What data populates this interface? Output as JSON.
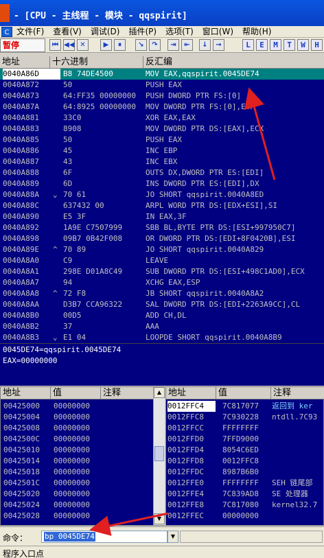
{
  "window": {
    "title": "- [CPU - 主线程 - 模块 - qqspirit]",
    "close_glyph": "×"
  },
  "menu": {
    "items": [
      "文件(F)",
      "查看(V)",
      "调试(D)",
      "插件(P)",
      "选项(T)",
      "窗口(W)",
      "帮助(H)"
    ],
    "system_glyph": "C"
  },
  "toolbar": {
    "status": "暂停",
    "buttons": [
      "⏮",
      "◀◀",
      "✕",
      "▶",
      "⏸",
      "↘",
      "↷",
      "⇥",
      "⇤",
      "↓",
      "→"
    ],
    "letters": [
      "L",
      "E",
      "M",
      "T",
      "W",
      "H"
    ]
  },
  "cpu": {
    "headers": [
      "地址",
      "十六进制",
      "反汇编"
    ],
    "rows": [
      {
        "addr": "0040A86D",
        "mark": "",
        "hex": "B8 74DE4500",
        "asm": "MOV EAX,qqspirit.0045DE74",
        "selected": true
      },
      {
        "addr": "0040A872",
        "mark": "",
        "hex": "50",
        "asm": "PUSH EAX"
      },
      {
        "addr": "0040A873",
        "mark": "",
        "hex": "64:FF35 00000000",
        "asm": "PUSH DWORD PTR FS:[0]"
      },
      {
        "addr": "0040A87A",
        "mark": "",
        "hex": "64:8925 00000000",
        "asm": "MOV DWORD PTR FS:[0],ESP"
      },
      {
        "addr": "0040A881",
        "mark": "",
        "hex": "33C0",
        "asm": "XOR EAX,EAX"
      },
      {
        "addr": "0040A883",
        "mark": "",
        "hex": "8908",
        "asm": "MOV DWORD PTR DS:[EAX],ECX"
      },
      {
        "addr": "0040A885",
        "mark": "",
        "hex": "50",
        "asm": "PUSH EAX"
      },
      {
        "addr": "0040A886",
        "mark": "",
        "hex": "45",
        "asm": "INC EBP"
      },
      {
        "addr": "0040A887",
        "mark": "",
        "hex": "43",
        "asm": "INC EBX"
      },
      {
        "addr": "0040A888",
        "mark": "",
        "hex": "6F",
        "asm": "OUTS DX,DWORD PTR ES:[EDI]"
      },
      {
        "addr": "0040A889",
        "mark": "",
        "hex": "6D",
        "asm": "INS DWORD PTR ES:[EDI],DX"
      },
      {
        "addr": "0040A88A",
        "mark": "⌄",
        "hex": "70 61",
        "asm": "JO SHORT qqspirit.0040A8ED"
      },
      {
        "addr": "0040A88C",
        "mark": "",
        "hex": "637432 00",
        "asm": "ARPL WORD PTR DS:[EDX+ESI],SI"
      },
      {
        "addr": "0040A890",
        "mark": "",
        "hex": "E5 3F",
        "asm": "IN EAX,3F"
      },
      {
        "addr": "0040A892",
        "mark": "",
        "hex": "1A9E C7507999",
        "asm": "SBB BL,BYTE PTR DS:[ESI+997950C7]"
      },
      {
        "addr": "0040A898",
        "mark": "",
        "hex": "09B7 0B42F008",
        "asm": "OR DWORD PTR DS:[EDI+8F0420B],ESI"
      },
      {
        "addr": "0040A89E",
        "mark": "^",
        "hex": "70 89",
        "asm": "JO SHORT qqspirit.0040A829"
      },
      {
        "addr": "0040A8A0",
        "mark": "",
        "hex": "C9",
        "asm": "LEAVE"
      },
      {
        "addr": "0040A8A1",
        "mark": "",
        "hex": "298E D01A8C49",
        "asm": "SUB DWORD PTR DS:[ESI+498C1AD0],ECX"
      },
      {
        "addr": "0040A8A7",
        "mark": "",
        "hex": "94",
        "asm": "XCHG EAX,ESP"
      },
      {
        "addr": "0040A8A8",
        "mark": "^",
        "hex": "72 F8",
        "asm": "JB SHORT qqspirit.0040A8A2"
      },
      {
        "addr": "0040A8AA",
        "mark": "",
        "hex": "D3B7 CCA96322",
        "asm": "SAL DWORD PTR DS:[EDI+2263A9CC],CL"
      },
      {
        "addr": "0040A8B0",
        "mark": "",
        "hex": "00D5",
        "asm": "ADD CH,DL"
      },
      {
        "addr": "0040A8B2",
        "mark": "",
        "hex": "37",
        "asm": "AAA"
      },
      {
        "addr": "0040A8B3",
        "mark": "⌄",
        "hex": "E1 04",
        "asm": "LOOPDE SHORT qqspirit.0040A8B9"
      }
    ]
  },
  "info": {
    "line1": "0045DE74=qqspirit.0045DE74",
    "line2": "EAX=00000000"
  },
  "dump": {
    "headers": [
      "地址",
      "值",
      "注释"
    ],
    "rows": [
      {
        "addr": "00425000",
        "val": "00000000"
      },
      {
        "addr": "00425004",
        "val": "00000000"
      },
      {
        "addr": "00425008",
        "val": "00000000"
      },
      {
        "addr": "0042500C",
        "val": "00000000"
      },
      {
        "addr": "00425010",
        "val": "00000000"
      },
      {
        "addr": "00425014",
        "val": "00000000"
      },
      {
        "addr": "00425018",
        "val": "00000000"
      },
      {
        "addr": "0042501C",
        "val": "00000000"
      },
      {
        "addr": "00425020",
        "val": "00000000"
      },
      {
        "addr": "00425024",
        "val": "00000000"
      },
      {
        "addr": "00425028",
        "val": "00000000"
      }
    ]
  },
  "stack": {
    "headers": [
      "地址",
      "值",
      "注释"
    ],
    "rows": [
      {
        "addr": "0012FFC4",
        "val": "7C817077",
        "comment": "返回到 ker",
        "selected": true
      },
      {
        "addr": "0012FFC8",
        "val": "7C930228",
        "comment": "ntdll.7C93"
      },
      {
        "addr": "0012FFCC",
        "val": "FFFFFFFF",
        "comment": ""
      },
      {
        "addr": "0012FFD0",
        "val": "7FFD9000",
        "comment": ""
      },
      {
        "addr": "0012FFD4",
        "val": "8054C6ED",
        "comment": ""
      },
      {
        "addr": "0012FFD8",
        "val": "0012FFC8",
        "comment": ""
      },
      {
        "addr": "0012FFDC",
        "val": "8987B6B0",
        "comment": ""
      },
      {
        "addr": "0012FFE0",
        "val": "FFFFFFFF",
        "comment": "SEH 链尾部"
      },
      {
        "addr": "0012FFE4",
        "val": "7C839AD8",
        "comment": "SE 处理器"
      },
      {
        "addr": "0012FFE8",
        "val": "7C817080",
        "comment": "kernel32.7"
      },
      {
        "addr": "0012FFEC",
        "val": "00000000",
        "comment": ""
      }
    ]
  },
  "command": {
    "label": "命令：",
    "value": "bp 0045DE74",
    "dropdown_glyph": "▼"
  },
  "status_bar": {
    "text": "程序入口点"
  },
  "colors": {
    "pane_bg": "#000080",
    "selection": "#008080",
    "annotation_arrow": "#e02020",
    "status_red": "#e00000"
  }
}
